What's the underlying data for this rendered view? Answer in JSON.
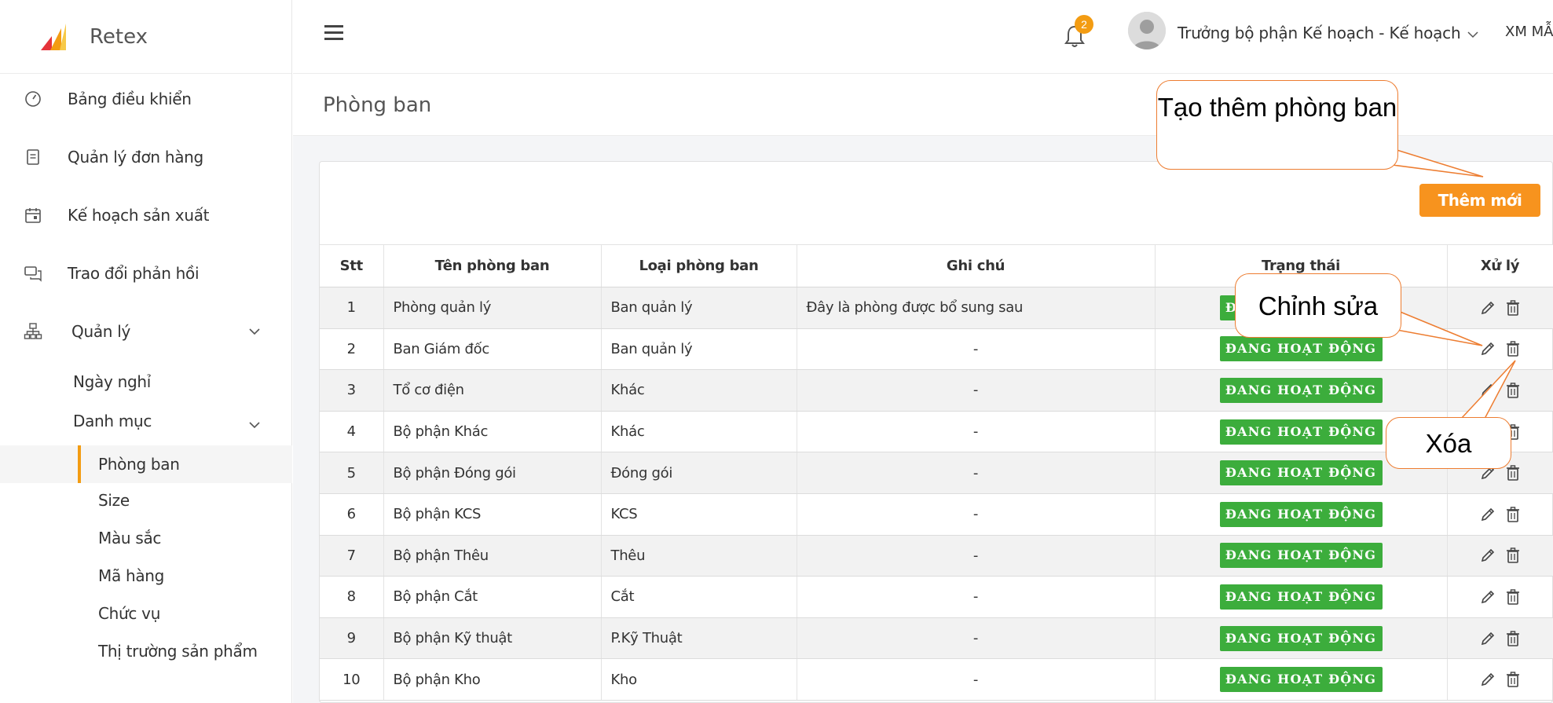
{
  "app": {
    "name": "Retex",
    "brand_color": "#f39c12"
  },
  "sidebar": {
    "items": [
      {
        "label": "Bảng điều khiển",
        "icon": "dashboard-gauge-icon"
      },
      {
        "label": "Quản lý đơn hàng",
        "icon": "order-list-icon"
      },
      {
        "label": "Kế hoạch sản xuất",
        "icon": "calendar-icon"
      },
      {
        "label": "Trao đổi phản hồi",
        "icon": "chat-bubbles-icon"
      },
      {
        "label": "Quản lý",
        "icon": "org-chart-icon",
        "expanded": true
      }
    ],
    "manage_children": [
      {
        "label": "Ngày nghỉ"
      },
      {
        "label": "Danh mục",
        "expanded": true
      }
    ],
    "catalog_children": [
      {
        "label": "Phòng ban",
        "active": true
      },
      {
        "label": "Size"
      },
      {
        "label": "Màu sắc"
      },
      {
        "label": "Mã hàng"
      },
      {
        "label": "Chức vụ"
      },
      {
        "label": "Thị trường sản phẩm"
      }
    ]
  },
  "header": {
    "menu_icon": "hamburger-menu-icon",
    "notification_count": "2",
    "user_name": "Trưởng bộ phận Kế hoạch - Kế hoạch",
    "org_name": "XM MẪU"
  },
  "page": {
    "title": "Phòng ban",
    "add_button": "Thêm mới"
  },
  "table": {
    "columns": [
      "Stt",
      "Tên phòng ban",
      "Loại phòng ban",
      "Ghi chú",
      "Trạng thái",
      "Xử lý"
    ],
    "rows": [
      {
        "stt": "1",
        "name": "Phòng quản lý",
        "type": "Ban quản lý",
        "note": "Đây là phòng được bổ sung sau",
        "status": "ĐANG HOẠT ĐỘNG"
      },
      {
        "stt": "2",
        "name": "Ban Giám đốc",
        "type": "Ban quản lý",
        "note": "-",
        "status": "ĐANG HOẠT ĐỘNG"
      },
      {
        "stt": "3",
        "name": "Tổ cơ điện",
        "type": "Khác",
        "note": "-",
        "status": "ĐANG HOẠT ĐỘNG"
      },
      {
        "stt": "4",
        "name": "Bộ phận Khác",
        "type": "Khác",
        "note": "-",
        "status": "ĐANG HOẠT ĐỘNG"
      },
      {
        "stt": "5",
        "name": "Bộ phận Đóng gói",
        "type": "Đóng gói",
        "note": "-",
        "status": "ĐANG HOẠT ĐỘNG"
      },
      {
        "stt": "6",
        "name": "Bộ phận KCS",
        "type": "KCS",
        "note": "-",
        "status": "ĐANG HOẠT ĐỘNG"
      },
      {
        "stt": "7",
        "name": "Bộ phận Thêu",
        "type": "Thêu",
        "note": "-",
        "status": "ĐANG HOẠT ĐỘNG"
      },
      {
        "stt": "8",
        "name": "Bộ phận Cắt",
        "type": "Cắt",
        "note": "-",
        "status": "ĐANG HOẠT ĐỘNG"
      },
      {
        "stt": "9",
        "name": "Bộ phận Kỹ thuật",
        "type": "P.Kỹ Thuật",
        "note": "-",
        "status": "ĐANG HOẠT ĐỘNG"
      },
      {
        "stt": "10",
        "name": "Bộ phận Kho",
        "type": "Kho",
        "note": "-",
        "status": "ĐANG HOẠT ĐỘNG"
      }
    ],
    "status_color": "#3cad3c"
  },
  "callouts": {
    "add": "Tạo thêm phòng ban",
    "edit": "Chỉnh sửa",
    "delete": "Xóa",
    "border_color": "#ed7d31"
  }
}
